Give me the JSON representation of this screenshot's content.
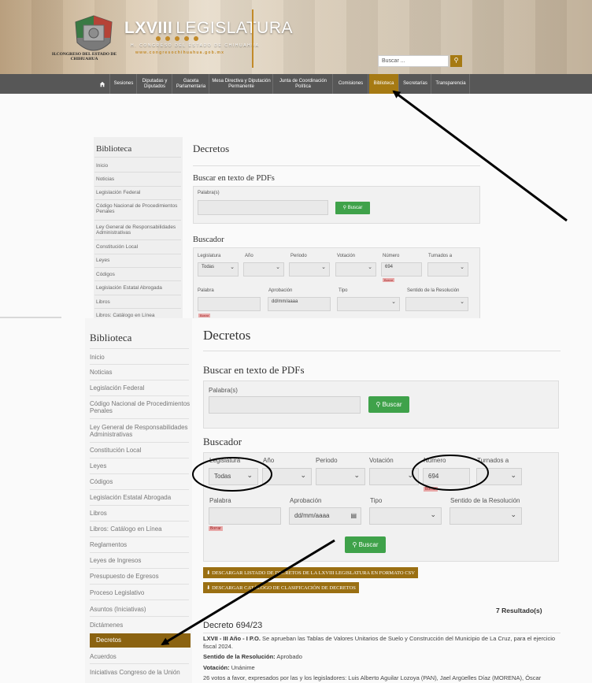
{
  "header": {
    "title_bold": "LXVIII",
    "title_rest": "LEGISLATURA",
    "subtitle": "H. CONGRESO DEL ESTADO DE CHIHUAHUA",
    "url": "www.congresochihuahua.gob.mx",
    "state_name": "H.CONGRESO DEL ESTADO DE CHIHUAHUA",
    "search_placeholder": "Buscar ...",
    "search_icon": "magnifier-icon"
  },
  "nav": {
    "home_icon": "home-icon",
    "items": [
      "Sesiones",
      "Diputadas y Diputados",
      "Gaceta Parlamentaria",
      "Mesa Directiva y Diputación Permanente",
      "Junta de Coordinación Política",
      "Comisiones",
      "Biblioteca",
      "Secretarías",
      "Transparencia"
    ]
  },
  "sidebar": {
    "title": "Biblioteca",
    "items": [
      "Inicio",
      "Noticias",
      "Legislación Federal",
      "Código Nacional de Procedimientos Penales",
      "Ley General de Responsabilidades Administrativas",
      "Constitución Local",
      "Leyes",
      "Códigos",
      "Legislación Estatal Abrogada",
      "Libros",
      "Libros: Catálogo en Línea",
      "Reglamentos",
      "Leyes de Ingresos",
      "Presupuesto de Egresos",
      "Proceso Legislativo",
      "Asuntos (Iniciativas)",
      "Dictámenes",
      "Decretos",
      "Acuerdos",
      "Iniciativas Congreso de la Unión"
    ]
  },
  "page": {
    "title": "Decretos",
    "pdf_search_title": "Buscar en texto de PDFs",
    "palabras_label": "Palabra(s)",
    "buscar_button": "Buscar",
    "buscador_title": "Buscador",
    "labels": {
      "legislatura": "Legislatura",
      "anio": "Año",
      "periodo": "Periodo",
      "votacion": "Votación",
      "numero": "Número",
      "turnados": "Turnados a",
      "palabra": "Palabra",
      "aprobacion": "Aprobación",
      "tipo": "Tipo",
      "sentido": "Sentido de la Resolución"
    },
    "legislatura_value": "Todas",
    "numero_value": "694",
    "date_placeholder": "dd/mm/aaaa",
    "borrar": "Borrar",
    "download_csv": "DESCARGAR LISTADO DE DECRETOS DE LA LXVIII LEGISLATURA EN FORMATO CSV",
    "download_catalog": "DESCARGAR CATÁLOGO DE CLASIFICACIÓN DE DECRETOS",
    "results": "7 Resultado(s)",
    "decreto_title": "Decreto 694/23",
    "decreto_lead": "LXVII - III Año - I P.O.",
    "decreto_desc": "Se aprueban las Tablas de Valores Unitarios de Suelo y Construcción del Municipio de La Cruz, para el ejercicio fiscal 2024.",
    "sentido_label": "Sentido de la Resolución:",
    "sentido_value": "Aprobado",
    "votacion_label": "Votación:",
    "votacion_value": "Unánime",
    "votos_text": "26 votos a favor, expresados por las y los legisladores: Luis Alberto Aguilar Lozoya (PAN), Jael Argüelles Díaz (MORENA), Óscar"
  },
  "colors": {
    "nav_bg": "#575757",
    "gold": "#a67a13",
    "green_button": "#3fa24a",
    "active_sidebar": "#8b6311"
  }
}
